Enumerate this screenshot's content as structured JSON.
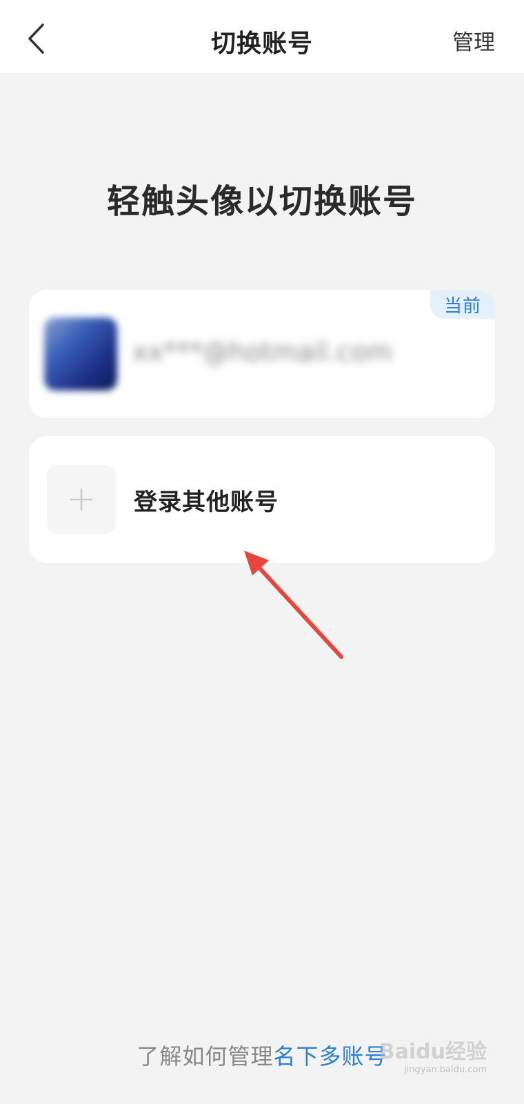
{
  "header": {
    "title": "切换账号",
    "manage_label": "管理",
    "back_icon": "chevron-left-icon"
  },
  "main": {
    "heading": "轻触头像以切换账号",
    "current_account": {
      "email": "xx***@hotmail.com",
      "badge": "当前"
    },
    "add_account": {
      "label": "登录其他账号",
      "icon": "plus-icon"
    }
  },
  "footer": {
    "text_prefix": "了解如何管理",
    "text_link": "名下多账号"
  },
  "watermark": {
    "brand": "Baidu经验",
    "url": "jingyan.baidu.com"
  },
  "colors": {
    "accent": "#2a7ed8",
    "badge_bg": "#e5f0fd",
    "background": "#f3f3f3",
    "annotation_arrow": "#e8453c"
  }
}
